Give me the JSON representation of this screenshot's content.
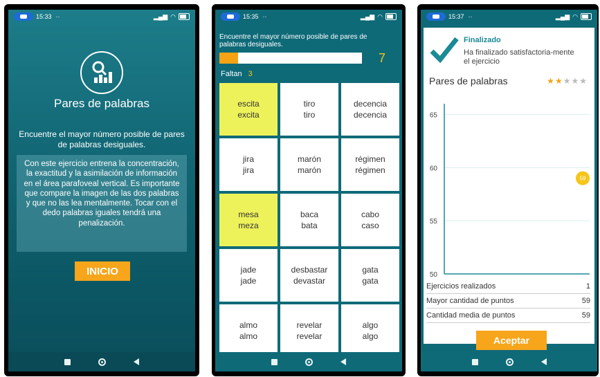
{
  "screen1": {
    "status": {
      "time": "15:33",
      "extra": "··",
      "battery": "76"
    },
    "logo_icon": "search-chart-icon",
    "title": "Pares de palabras",
    "intro": "Encuentre el mayor número posible de pares de palabras desiguales.",
    "description": "Con este ejercicio entrena la concentración, la exactitud y la asimilación de información en el área parafoveal vertical. Es importante que compare la imagen de las dos palabras y que no las lea mentalmente. Tocar con el dedo palabras iguales tendrá una penalización.",
    "start_button": "INICIO"
  },
  "screen2": {
    "status": {
      "time": "15:35",
      "extra": "··",
      "battery": "76"
    },
    "instruction": "Encuentre el mayor número posible de pares de palabras desiguales.",
    "progress": 0.13,
    "score": "7",
    "faltan_label": "Faltan",
    "faltan_value": "3",
    "grid": [
      {
        "top": "escita",
        "bottom": "excita",
        "selected": true
      },
      {
        "top": "tiro",
        "bottom": "tiro",
        "selected": false
      },
      {
        "top": "decencia",
        "bottom": "decencia",
        "selected": false
      },
      {
        "top": "jira",
        "bottom": "jira",
        "selected": false
      },
      {
        "top": "marón",
        "bottom": "marón",
        "selected": false
      },
      {
        "top": "régimen",
        "bottom": "régimen",
        "selected": false
      },
      {
        "top": "mesa",
        "bottom": "meza",
        "selected": true
      },
      {
        "top": "baca",
        "bottom": "bata",
        "selected": false
      },
      {
        "top": "cabo",
        "bottom": "caso",
        "selected": false
      },
      {
        "top": "jade",
        "bottom": "jade",
        "selected": false
      },
      {
        "top": "desbastar",
        "bottom": "devastar",
        "selected": false
      },
      {
        "top": "gata",
        "bottom": "gata",
        "selected": false
      },
      {
        "top": "almo",
        "bottom": "almo",
        "selected": false
      },
      {
        "top": "revelar",
        "bottom": "revelar",
        "selected": false
      },
      {
        "top": "algo",
        "bottom": "algo",
        "selected": false
      }
    ]
  },
  "screen3": {
    "status": {
      "time": "15:37",
      "extra": "··",
      "battery": "76"
    },
    "finished_title": "Finalizado",
    "finished_message": "Ha finalizado satisfactoria-mente el ejercicio",
    "exercise_title": "Pares de palabras",
    "rating": {
      "filled": 2,
      "total": 5
    },
    "chart_data": {
      "type": "scatter",
      "title": "",
      "xlabel": "",
      "ylabel": "",
      "yticks": [
        65,
        60,
        55,
        50
      ],
      "ylim": [
        50,
        66
      ],
      "x": [
        1
      ],
      "y": [
        59
      ],
      "point_labels": [
        "59"
      ],
      "point_color": "#f5c518",
      "grid": true
    },
    "stats": [
      {
        "label": "Ejercicios realizados",
        "value": "1"
      },
      {
        "label": "Mayor cantidad de puntos",
        "value": "59"
      },
      {
        "label": "Cantidad media de puntos",
        "value": "59"
      }
    ],
    "accept_button": "Aceptar"
  },
  "colors": {
    "teal": "#0f6a78",
    "accent": "#f7a51a",
    "highlight": "#eef25a"
  }
}
